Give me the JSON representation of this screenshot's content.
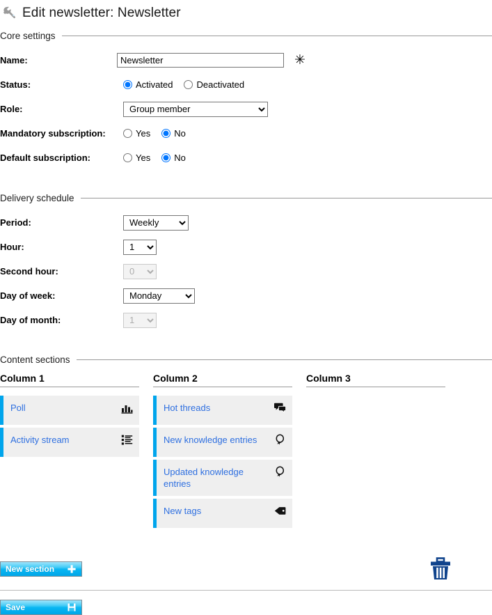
{
  "header": {
    "icon": "wrench-icon",
    "title": "Edit newsletter: Newsletter"
  },
  "core_settings": {
    "legend": "Core settings",
    "name": {
      "label": "Name:",
      "value": "Newsletter",
      "required_marker": "✳"
    },
    "status": {
      "label": "Status:",
      "options": [
        "Activated",
        "Deactivated"
      ],
      "selected": "Activated"
    },
    "role": {
      "label": "Role:",
      "value": "Group member",
      "options": [
        "Group member"
      ]
    },
    "mandatory_subscription": {
      "label": "Mandatory subscription:",
      "options": [
        "Yes",
        "No"
      ],
      "selected": "No"
    },
    "default_subscription": {
      "label": "Default subscription:",
      "options": [
        "Yes",
        "No"
      ],
      "selected": "No"
    }
  },
  "delivery_schedule": {
    "legend": "Delivery schedule",
    "period": {
      "label": "Period:",
      "value": "Weekly",
      "options": [
        "Weekly"
      ],
      "disabled": false
    },
    "hour": {
      "label": "Hour:",
      "value": "1",
      "options": [
        "1"
      ],
      "disabled": false
    },
    "second_hour": {
      "label": "Second hour:",
      "value": "0",
      "options": [
        "0"
      ],
      "disabled": true
    },
    "day_of_week": {
      "label": "Day of week:",
      "value": "Monday",
      "options": [
        "Monday"
      ],
      "disabled": false
    },
    "day_of_month": {
      "label": "Day of month:",
      "value": "1",
      "options": [
        "1"
      ],
      "disabled": true
    }
  },
  "content_sections": {
    "legend": "Content sections",
    "columns": [
      {
        "title": "Column 1",
        "items": [
          {
            "label": "Poll",
            "icon": "bar-chart-icon"
          },
          {
            "label": "Activity stream",
            "icon": "list-icon"
          }
        ]
      },
      {
        "title": "Column 2",
        "items": [
          {
            "label": "Hot threads",
            "icon": "speech-bubbles-icon"
          },
          {
            "label": "New knowledge entries",
            "icon": "lightbulb-icon"
          },
          {
            "label": "Updated knowledge entries",
            "icon": "lightbulb-icon"
          },
          {
            "label": "New tags",
            "icon": "tag-icon"
          }
        ]
      },
      {
        "title": "Column 3",
        "items": []
      }
    ]
  },
  "footer": {
    "new_section_label": "New section",
    "new_section_icon": "plus-icon",
    "delete_icon": "trash-icon",
    "save_label": "Save",
    "save_icon": "floppy-disk-icon"
  },
  "colors": {
    "accent": "#00a5ec",
    "link": "#2e6fe0",
    "item_bg": "#efefef",
    "trash": "#10438c",
    "rule": "#999999"
  }
}
